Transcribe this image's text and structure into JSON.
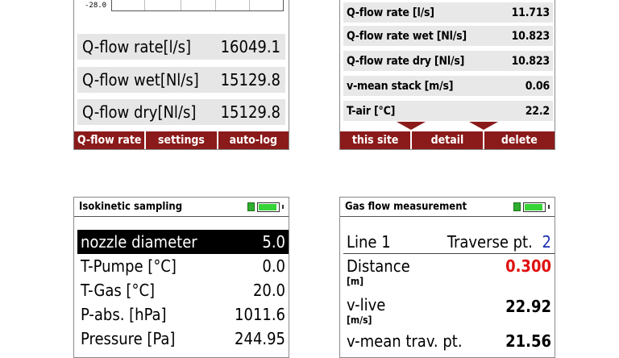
{
  "panel_qflow": {
    "chart_tick": "-28.0",
    "rows": [
      {
        "label": "Q-flow rate[l/s]",
        "value": "16049.1"
      },
      {
        "label": "Q-flow wet[Nl/s]",
        "value": "15129.8"
      },
      {
        "label": "Q-flow dry[Nl/s]",
        "value": "15129.8"
      }
    ],
    "softkeys": [
      "Q-flow rate",
      "settings",
      "auto-log"
    ]
  },
  "panel_site": {
    "rows": [
      {
        "label": "Q-flow rate [l/s]",
        "value": "11.713"
      },
      {
        "label": "Q-flow rate wet [Nl/s]",
        "value": "10.823"
      },
      {
        "label": "Q-flow rate dry [Nl/s]",
        "value": "10.823"
      },
      {
        "label": "v-mean stack  [m/s]",
        "value": "0.06"
      },
      {
        "label": "T-air [°C]",
        "value": "22.2"
      }
    ],
    "softkeys": [
      "this site",
      "detail",
      "delete"
    ],
    "colors": {
      "softkey_bg": "#8b1a1a"
    }
  },
  "panel_isokinetic": {
    "title": "Isokinetic sampling",
    "battery_level": 0.9,
    "rows": [
      {
        "label": "nozzle diameter",
        "value": "5.0",
        "selected": true
      },
      {
        "label": "T-Pumpe [°C]",
        "value": "0.0"
      },
      {
        "label": "T-Gas [°C]",
        "value": "20.0"
      },
      {
        "label": "P-abs. [hPa]",
        "value": "1011.6"
      },
      {
        "label": "Pressure [Pa]",
        "value": "244.95"
      }
    ]
  },
  "panel_gasflow": {
    "title": "Gas flow measurement",
    "battery_level": 0.9,
    "line_label": "Line 1",
    "traverse_label": "Traverse pt.",
    "traverse_value": "2",
    "rows": [
      {
        "label": "Distance",
        "unit": "[m]",
        "value": "0.300",
        "color": "#e01010"
      },
      {
        "label": "v-live",
        "unit": "[m/s]",
        "value": "22.92",
        "color": "#000000"
      },
      {
        "label": "v-mean trav. pt.",
        "unit": "",
        "value": "21.56",
        "color": "#000000"
      }
    ],
    "colors": {
      "traverse_value": "#1a2fb0"
    }
  }
}
